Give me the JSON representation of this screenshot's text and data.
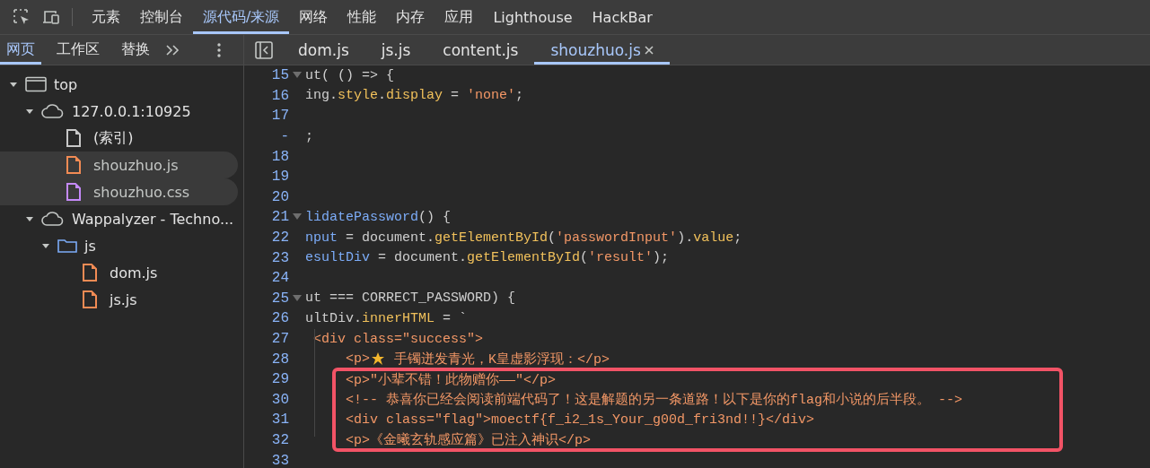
{
  "main_tabs": [
    {
      "label": "元素",
      "selected": false
    },
    {
      "label": "控制台",
      "selected": false
    },
    {
      "label": "源代码/来源",
      "selected": true
    },
    {
      "label": "网络",
      "selected": false
    },
    {
      "label": "性能",
      "selected": false
    },
    {
      "label": "内存",
      "selected": false
    },
    {
      "label": "应用",
      "selected": false
    },
    {
      "label": "Lighthouse",
      "selected": false
    },
    {
      "label": "HackBar",
      "selected": false
    }
  ],
  "sidebar": {
    "tabs": [
      {
        "label": "网页",
        "selected": true
      },
      {
        "label": "工作区",
        "selected": false
      },
      {
        "label": "替换",
        "selected": false
      }
    ],
    "tree": [
      {
        "label": "top",
        "kind": "frame",
        "expanded": true,
        "selected": false,
        "children": [
          {
            "label": "127.0.0.1:10925",
            "kind": "cloud",
            "expanded": true,
            "selected": false,
            "children": [
              {
                "label": "(索引)",
                "kind": "file",
                "color": "#c8c8c8",
                "selected": false
              },
              {
                "label": "shouzhuo.js",
                "kind": "file",
                "color": "#f28b54",
                "selected": true
              },
              {
                "label": "shouzhuo.css",
                "kind": "file",
                "color": "#c58af9",
                "selected": true
              }
            ]
          },
          {
            "label": "Wappalyzer - Techno...",
            "kind": "cloud",
            "expanded": true,
            "selected": false,
            "children": [
              {
                "label": "js",
                "kind": "folder",
                "expanded": true,
                "selected": false,
                "children": [
                  {
                    "label": "dom.js",
                    "kind": "file",
                    "color": "#f28b54",
                    "selected": false
                  },
                  {
                    "label": "js.js",
                    "kind": "file",
                    "color": "#f28b54",
                    "selected": false
                  }
                ]
              }
            ]
          }
        ]
      }
    ]
  },
  "editor": {
    "tabs": [
      {
        "label": "dom.js",
        "selected": false,
        "closable": false
      },
      {
        "label": "js.js",
        "selected": false,
        "closable": false
      },
      {
        "label": "content.js",
        "selected": false,
        "closable": false
      },
      {
        "label": "shouzhuo.js",
        "selected": true,
        "closable": true
      }
    ],
    "lines": [
      {
        "number": "15",
        "fold": true,
        "highlighted": false,
        "tokens": [
          {
            "kind": "plain",
            "text": "ut( () => {"
          }
        ]
      },
      {
        "number": "16",
        "fold": false,
        "highlighted": false,
        "tokens": [
          {
            "kind": "plain",
            "text": "ing."
          },
          {
            "kind": "prop",
            "text": "style"
          },
          {
            "kind": "plain",
            "text": "."
          },
          {
            "kind": "prop",
            "text": "display"
          },
          {
            "kind": "plain",
            "text": " = "
          },
          {
            "kind": "str",
            "text": "'none'"
          },
          {
            "kind": "plain",
            "text": ";"
          }
        ]
      },
      {
        "number": "17",
        "fold": false,
        "highlighted": false
      },
      {
        "number": "-",
        "fold": false,
        "highlighted": false,
        "tokens": [
          {
            "kind": "plain",
            "text": ";"
          }
        ]
      },
      {
        "number": "18",
        "fold": false,
        "highlighted": false
      },
      {
        "number": "19",
        "fold": false,
        "highlighted": false
      },
      {
        "number": "20",
        "fold": false,
        "highlighted": false
      },
      {
        "number": "21",
        "fold": true,
        "highlighted": false,
        "tokens": [
          {
            "kind": "var",
            "text": "lidatePassword"
          },
          {
            "kind": "plain",
            "text": "() {"
          }
        ]
      },
      {
        "number": "22",
        "fold": false,
        "highlighted": false,
        "tokens": [
          {
            "kind": "var",
            "text": "nput"
          },
          {
            "kind": "plain",
            "text": " = document."
          },
          {
            "kind": "prop",
            "text": "getElementById"
          },
          {
            "kind": "plain",
            "text": "("
          },
          {
            "kind": "str",
            "text": "'passwordInput'"
          },
          {
            "kind": "plain",
            "text": ")."
          },
          {
            "kind": "prop",
            "text": "value"
          },
          {
            "kind": "plain",
            "text": ";"
          }
        ]
      },
      {
        "number": "23",
        "fold": false,
        "highlighted": false,
        "tokens": [
          {
            "kind": "var",
            "text": "esultDiv"
          },
          {
            "kind": "plain",
            "text": " = document."
          },
          {
            "kind": "prop",
            "text": "getElementById"
          },
          {
            "kind": "plain",
            "text": "("
          },
          {
            "kind": "str",
            "text": "'result'"
          },
          {
            "kind": "plain",
            "text": ");"
          }
        ]
      },
      {
        "number": "24",
        "fold": false,
        "highlighted": false
      },
      {
        "number": "25",
        "fold": true,
        "highlighted": false,
        "tokens": [
          {
            "kind": "plain",
            "text": "ut === CORRECT_PASSWORD) {"
          }
        ]
      },
      {
        "number": "26",
        "fold": false,
        "highlighted": false,
        "tokens": [
          {
            "kind": "plain",
            "text": "ultDiv."
          },
          {
            "kind": "prop",
            "text": "innerHTML"
          },
          {
            "kind": "plain",
            "text": " = `"
          }
        ]
      },
      {
        "number": "27",
        "fold": false,
        "highlighted": false,
        "tokens": [
          {
            "kind": "str",
            "text": " <div class=\"success\">"
          }
        ]
      },
      {
        "number": "28",
        "fold": false,
        "highlighted": false,
        "tokens": [
          {
            "kind": "str",
            "text": "     <p>"
          },
          {
            "kind": "icon"
          },
          {
            "kind": "str",
            "text": " 手镯迸发青光，K皇虚影浮现：</p>"
          }
        ]
      },
      {
        "number": "29",
        "fold": false,
        "highlighted": true,
        "tokens": [
          {
            "kind": "str",
            "text": "     <p>\"小辈不错！此物赠你——\"</p>"
          }
        ]
      },
      {
        "number": "30",
        "fold": false,
        "highlighted": true,
        "tokens": [
          {
            "kind": "str",
            "text": "     <!-- 恭喜你已经会阅读前端代码了！这是解题的另一条道路！以下是你的flag和小说的后半段。 -->"
          }
        ]
      },
      {
        "number": "31",
        "fold": false,
        "highlighted": true,
        "tokens": [
          {
            "kind": "str",
            "text": "     <div class=\"flag\">moectf{f_i2_1s_Your_g00d_fri3nd!!}</div>"
          }
        ]
      },
      {
        "number": "32",
        "fold": false,
        "highlighted": true,
        "tokens": [
          {
            "kind": "str",
            "text": "     <p>《金曦玄轨感应篇》已注入神识</p>"
          }
        ]
      },
      {
        "number": "33",
        "fold": false,
        "highlighted": false
      }
    ]
  }
}
